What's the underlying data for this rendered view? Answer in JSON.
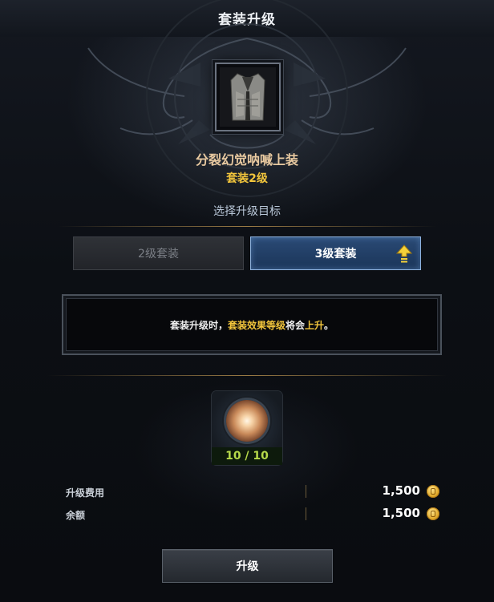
{
  "window": {
    "title": "套装升级"
  },
  "item": {
    "name": "分裂幻觉呐喊上装",
    "set_level": "套装2级",
    "icon": "robe-armor-icon"
  },
  "selection": {
    "label": "选择升级目标",
    "options": [
      {
        "label": "2级套装",
        "selected": false
      },
      {
        "label": "3级套装",
        "selected": true,
        "icon": "upgrade-arrow-icon"
      }
    ]
  },
  "description": {
    "part1": "套装升级时，",
    "highlight1": "套装效果等级",
    "part2": "将会",
    "highlight2": "上升",
    "part3": "。"
  },
  "material": {
    "icon": "glowing-orb-icon",
    "count": "10 / 10"
  },
  "costs": [
    {
      "label": "升级费用",
      "value": "1,500",
      "icon": "gold-coin-icon"
    },
    {
      "label": "余额",
      "value": "1,500",
      "icon": "gold-coin-icon"
    }
  ],
  "actions": {
    "upgrade_label": "升级"
  },
  "colors": {
    "accent_gold": "#f3c63c",
    "selected_blue": "#2a4a75",
    "count_green": "#b6d94a",
    "item_name": "#e8c9a0"
  }
}
